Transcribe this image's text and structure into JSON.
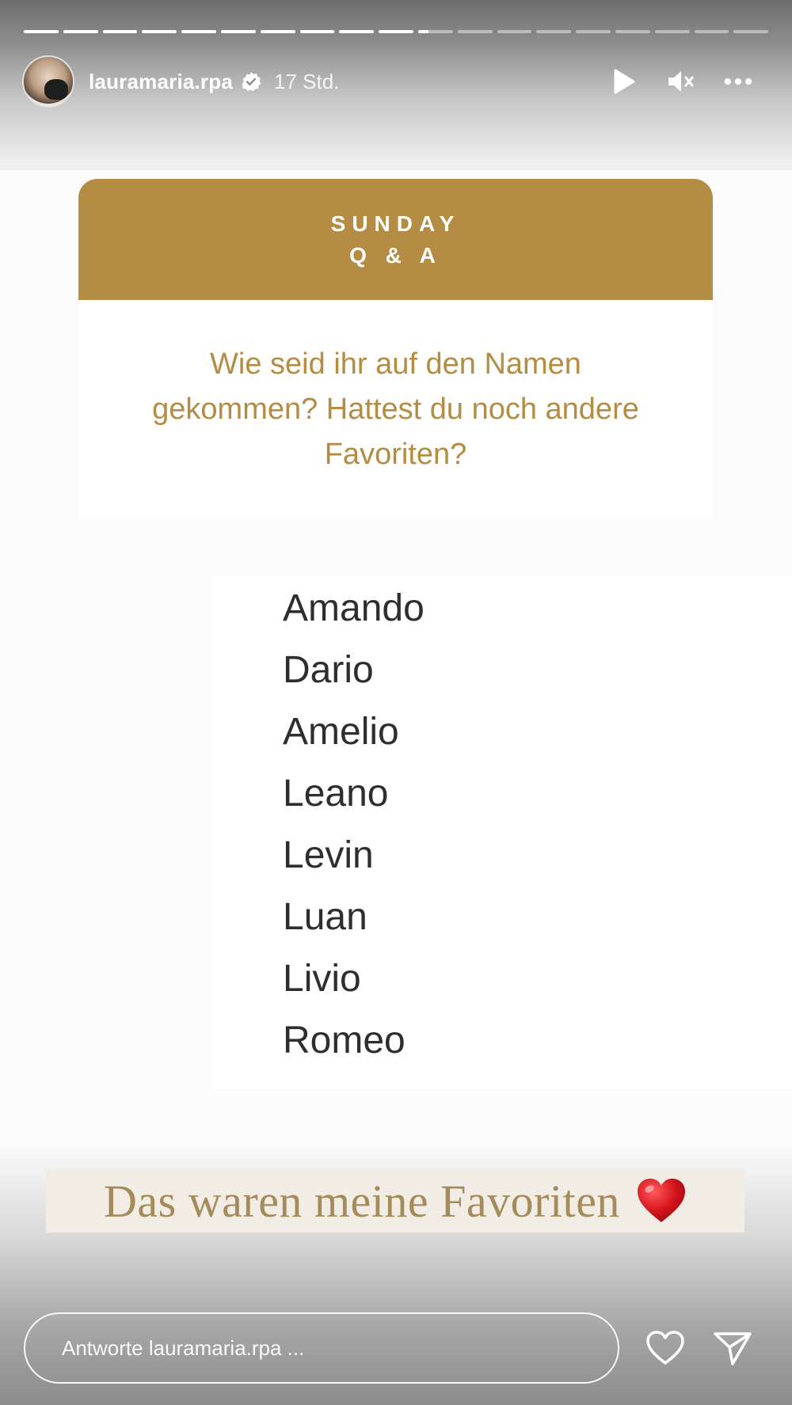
{
  "story": {
    "progress": {
      "segments": 19,
      "completed": 10,
      "current_fill": 0.3
    },
    "header": {
      "username": "lauramaria.rpa",
      "verified": true,
      "time": "17 Std.",
      "icons": {
        "play": "play-icon",
        "mute": "speaker-muted-icon",
        "more": "more-horizontal-icon"
      }
    },
    "qa": {
      "title_line1": "SUNDAY",
      "title_line2": "Q & A",
      "question": "Wie seid ihr auf den Namen gekommen? Hattest du noch andere Favoriten?",
      "accent_color": "#b48c43"
    },
    "names": [
      "Amando",
      "Dario",
      "Amelio",
      "Leano",
      "Levin",
      "Luan",
      "Livio",
      "Romeo"
    ],
    "caption": {
      "text": "Das waren meine Favoriten",
      "emoji": "red-heart"
    },
    "reply": {
      "placeholder": "Antworte lauramaria.rpa ...",
      "icons": {
        "like": "heart-outline-icon",
        "send": "send-icon"
      }
    }
  }
}
